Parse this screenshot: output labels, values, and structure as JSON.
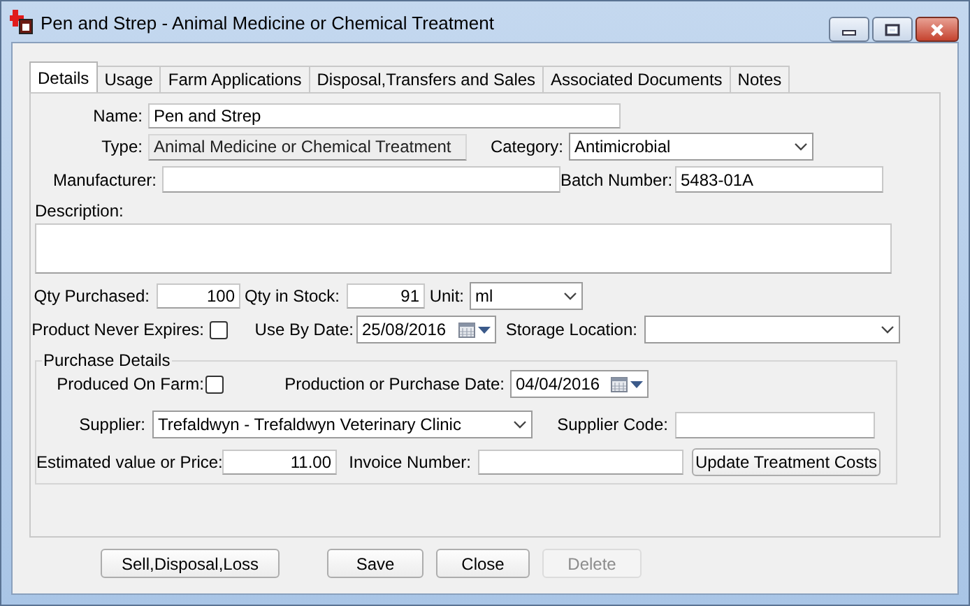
{
  "window": {
    "title": "Pen and Strep - Animal Medicine or Chemical Treatment"
  },
  "tabs": [
    {
      "label": "Details",
      "selected": true
    },
    {
      "label": "Usage",
      "selected": false
    },
    {
      "label": "Farm Applications",
      "selected": false
    },
    {
      "label": "Disposal,Transfers and Sales",
      "selected": false
    },
    {
      "label": "Associated Documents",
      "selected": false
    },
    {
      "label": "Notes",
      "selected": false
    }
  ],
  "rows": [
    [
      {
        "kind": "label",
        "text": "Name:"
      },
      {
        "kind": "field",
        "value": "Pen and Strep"
      }
    ],
    [
      {
        "kind": "label",
        "text": "Type:"
      },
      {
        "kind": "readonly",
        "value": "Animal Medicine or Chemical Treatment"
      },
      {
        "kind": "label",
        "text": "Category:"
      },
      {
        "kind": "combo",
        "value": "Antimicrobial"
      }
    ],
    [
      {
        "kind": "label",
        "text": "Manufacturer:"
      },
      {
        "kind": "field"
      },
      {
        "kind": "label",
        "text": "Batch Number:"
      },
      {
        "kind": "field",
        "value": "5483-01A"
      }
    ],
    [
      {
        "kind": "label",
        "text": "Description:"
      }
    ],
    [
      {
        "kind": "textarea"
      }
    ],
    [
      {
        "kind": "label",
        "text": "Qty Purchased:"
      },
      {
        "kind": "number",
        "value": "100"
      },
      {
        "kind": "label",
        "text": "Qty in Stock:"
      },
      {
        "kind": "number",
        "value": "91"
      },
      {
        "kind": "label",
        "text": "Unit:"
      },
      {
        "kind": "combo",
        "value": "ml"
      }
    ],
    [
      {
        "kind": "label",
        "text": "Product Never Expires:"
      },
      {
        "kind": "checkbox",
        "checked": false
      },
      {
        "kind": "label",
        "text": "Use By Date:"
      },
      {
        "kind": "date",
        "value": "25/08/2016"
      },
      {
        "kind": "label",
        "text": "Storage Location:"
      },
      {
        "kind": "combo"
      }
    ]
  ],
  "purchase_details": {
    "title": "Purchase Details",
    "rows": [
      [
        {
          "kind": "label",
          "text": "Produced On Farm:"
        },
        {
          "kind": "checkbox",
          "checked": false
        },
        {
          "kind": "label",
          "text": "Production or Purchase Date:"
        },
        {
          "kind": "date",
          "value": "04/04/2016"
        }
      ],
      [
        {
          "kind": "label",
          "text": "Supplier:"
        },
        {
          "kind": "combo",
          "value": "Trefaldwyn - Trefaldwyn Veterinary Clinic"
        },
        {
          "kind": "label",
          "text": "Supplier Code:"
        },
        {
          "kind": "field"
        }
      ],
      [
        {
          "kind": "label",
          "text": "Estimated value or Price:"
        },
        {
          "kind": "number",
          "value": "11.00"
        },
        {
          "kind": "label",
          "text": "Invoice Number:"
        },
        {
          "kind": "field"
        },
        {
          "kind": "button",
          "label": "Update Treatment Costs"
        }
      ]
    ]
  },
  "buttons": [
    {
      "label": "Sell,Disposal,Loss",
      "disabled": false
    },
    {
      "label": "Save",
      "disabled": false
    },
    {
      "label": "Close",
      "disabled": false
    },
    {
      "label": "Delete",
      "disabled": true
    }
  ]
}
